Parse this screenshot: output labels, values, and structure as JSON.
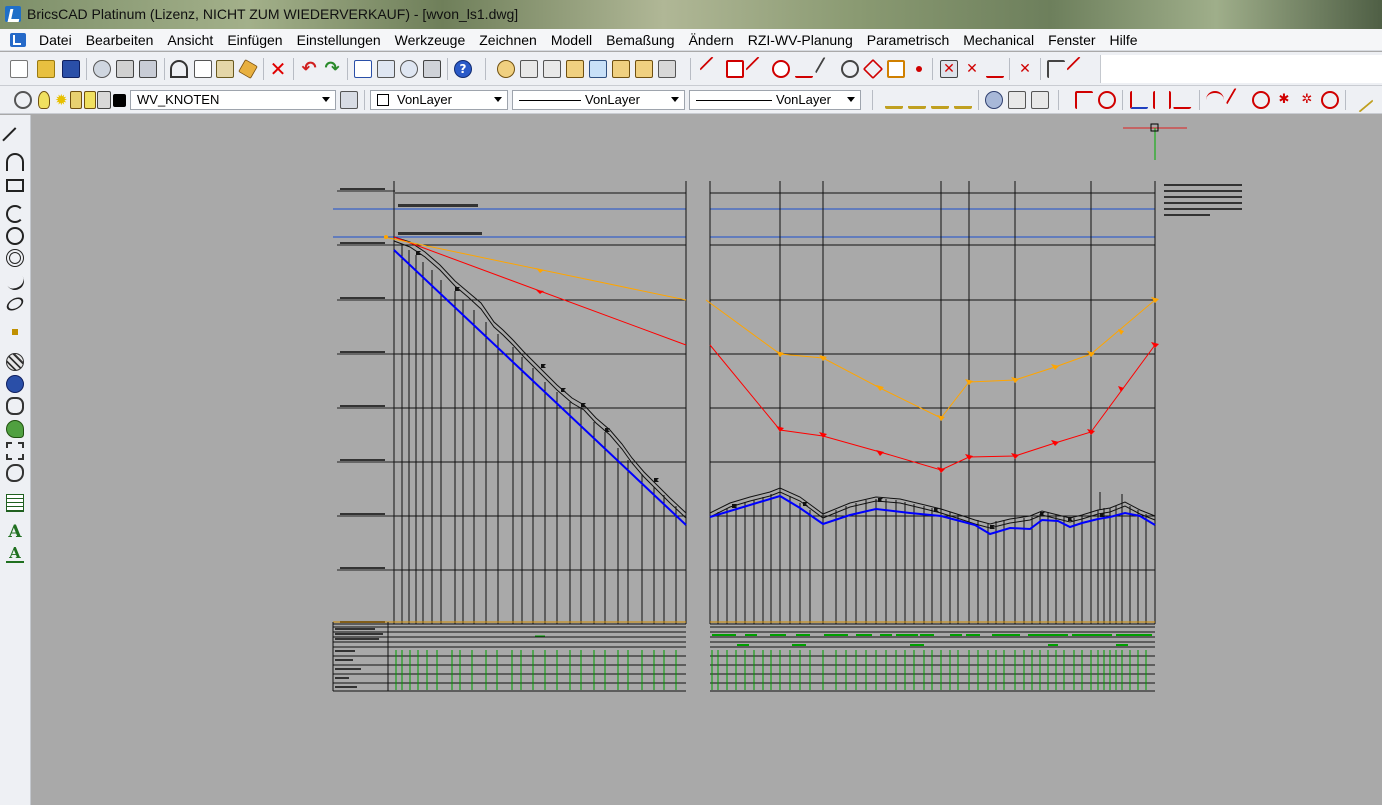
{
  "window": {
    "title": "BricsCAD Platinum (Lizenz, NICHT ZUM WIEDERVERKAUF) - [wvon_ls1.dwg]"
  },
  "menu": [
    "Datei",
    "Bearbeiten",
    "Ansicht",
    "Einfügen",
    "Einstellungen",
    "Werkzeuge",
    "Zeichnen",
    "Modell",
    "Bemaßung",
    "Ändern",
    "RZI-WV-Planung",
    "Parametrisch",
    "Mechanical",
    "Fenster",
    "Hilfe"
  ],
  "properties": {
    "layer": "WV_KNOTEN",
    "color": "VonLayer",
    "linetype": "VonLayer",
    "lineweight": "VonLayer"
  },
  "colors": {
    "surface_profile": "#111111",
    "pipe_blue": "#0000ff",
    "line_red": "#ff0000",
    "line_orange": "#ffa500",
    "band_green": "#00a000",
    "crosshair_red": "#e02020",
    "crosshair_green": "#00b000"
  },
  "icons": {
    "file": [
      "new-file-icon",
      "open-folder-icon",
      "save-icon",
      "preview-icon",
      "print-icon",
      "plot-icon",
      "cut-icon",
      "copy-icon",
      "paste-icon",
      "match-properties-icon",
      "delete-icon",
      "undo-icon",
      "redo-icon",
      "properties-icon",
      "layouts-icon",
      "find-icon",
      "drawing-explorer-icon",
      "help-icon"
    ],
    "left": [
      "line-icon",
      "arc-icon",
      "rectangle-icon",
      "circle-arc-icon",
      "circle-icon",
      "donut-icon",
      "spline-icon",
      "ellipse-icon",
      "point-icon",
      "hatch-icon",
      "region-icon",
      "boundary-icon",
      "revision-cloud-icon",
      "wipeout-icon",
      "cloud-icon",
      "table-icon",
      "text-icon",
      "mtext-icon"
    ]
  }
}
